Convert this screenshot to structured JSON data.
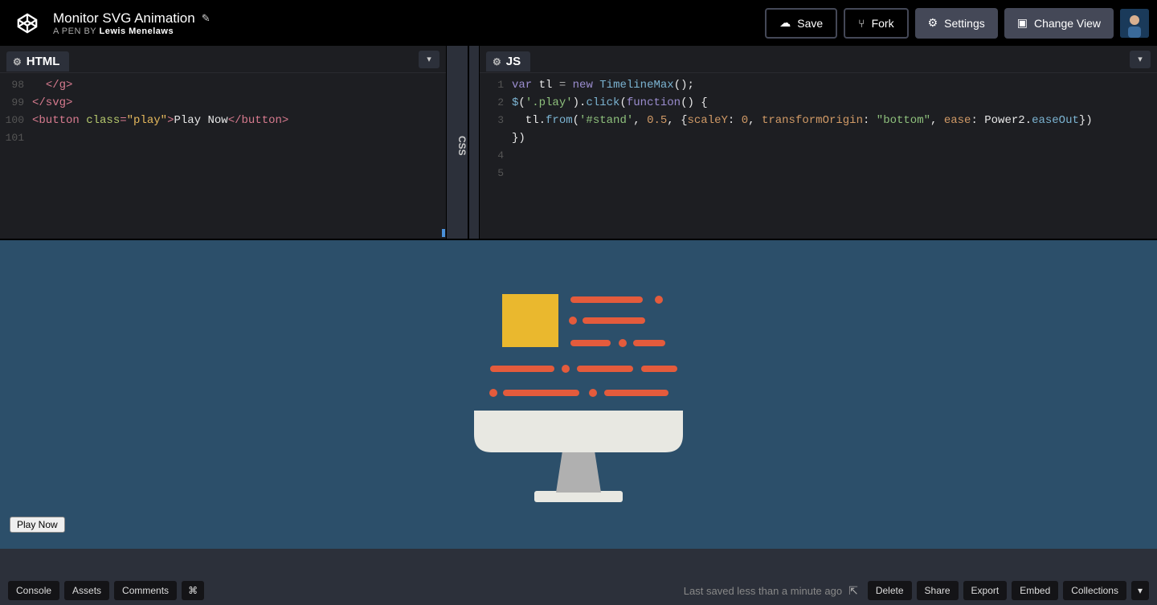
{
  "header": {
    "title": "Monitor SVG Animation",
    "byline_prefix": "A PEN BY ",
    "author": "Lewis Menelaws",
    "buttons": {
      "save": "Save",
      "fork": "Fork",
      "settings": "Settings",
      "change_view": "Change View"
    }
  },
  "editors": {
    "html": {
      "label": "HTML",
      "gutter": [
        "98",
        "99",
        "100",
        "101"
      ],
      "lines": [
        [
          {
            "t": "t-txt",
            "v": "  "
          },
          {
            "t": "t-tag",
            "v": "</g>"
          }
        ],
        [
          {
            "t": "t-tag",
            "v": "</svg>"
          }
        ],
        [
          {
            "t": "t-txt",
            "v": ""
          }
        ],
        [
          {
            "t": "t-tag",
            "v": "<button "
          },
          {
            "t": "t-attr",
            "v": "class"
          },
          {
            "t": "t-tag",
            "v": "="
          },
          {
            "t": "t-val",
            "v": "\"play\""
          },
          {
            "t": "t-tag",
            "v": ">"
          },
          {
            "t": "t-txt",
            "v": "Play Now"
          },
          {
            "t": "t-tag",
            "v": "</button>"
          }
        ]
      ]
    },
    "css": {
      "label": "CSS"
    },
    "js": {
      "label": "JS",
      "gutter": [
        "1",
        "2",
        "3",
        "",
        "4",
        "5"
      ],
      "lines": [
        [
          {
            "t": "t-kw",
            "v": "var"
          },
          {
            "t": "t-var",
            "v": " tl "
          },
          {
            "t": "t-op",
            "v": "= "
          },
          {
            "t": "t-kw",
            "v": "new"
          },
          {
            "t": "t-var",
            "v": " "
          },
          {
            "t": "t-fn",
            "v": "TimelineMax"
          },
          {
            "t": "t-var",
            "v": "();"
          }
        ],
        [
          {
            "t": "t-fn",
            "v": "$"
          },
          {
            "t": "t-var",
            "v": "("
          },
          {
            "t": "t-str",
            "v": "'.play'"
          },
          {
            "t": "t-var",
            "v": ")."
          },
          {
            "t": "t-fn",
            "v": "click"
          },
          {
            "t": "t-var",
            "v": "("
          },
          {
            "t": "t-kw",
            "v": "function"
          },
          {
            "t": "t-var",
            "v": "() {"
          }
        ],
        [
          {
            "t": "t-var",
            "v": "  tl."
          },
          {
            "t": "t-fn",
            "v": "from"
          },
          {
            "t": "t-var",
            "v": "("
          },
          {
            "t": "t-str",
            "v": "'#stand'"
          },
          {
            "t": "t-var",
            "v": ", "
          },
          {
            "t": "t-num",
            "v": "0.5"
          },
          {
            "t": "t-var",
            "v": ", {"
          },
          {
            "t": "t-prop",
            "v": "scaleY"
          },
          {
            "t": "t-var",
            "v": ": "
          },
          {
            "t": "t-num",
            "v": "0"
          },
          {
            "t": "t-var",
            "v": ", "
          },
          {
            "t": "t-prop",
            "v": "transformOrigin"
          },
          {
            "t": "t-var",
            "v": ": "
          },
          {
            "t": "t-str",
            "v": "\"bottom\""
          },
          {
            "t": "t-var",
            "v": ", "
          },
          {
            "t": "t-prop",
            "v": "ease"
          },
          {
            "t": "t-var",
            "v": ": Power2."
          },
          {
            "t": "t-fn",
            "v": "easeOut"
          },
          {
            "t": "t-var",
            "v": "})"
          }
        ],
        [
          {
            "t": "t-var",
            "v": ""
          }
        ],
        [
          {
            "t": "t-var",
            "v": "})"
          }
        ],
        [
          {
            "t": "t-var",
            "v": ""
          }
        ]
      ]
    }
  },
  "preview": {
    "play_button": "Play Now"
  },
  "footer": {
    "left": [
      "Console",
      "Assets",
      "Comments",
      "⌘"
    ],
    "status": "Last saved less than a minute ago",
    "right": [
      "Delete",
      "Share",
      "Export",
      "Embed",
      "Collections",
      "▾"
    ]
  }
}
